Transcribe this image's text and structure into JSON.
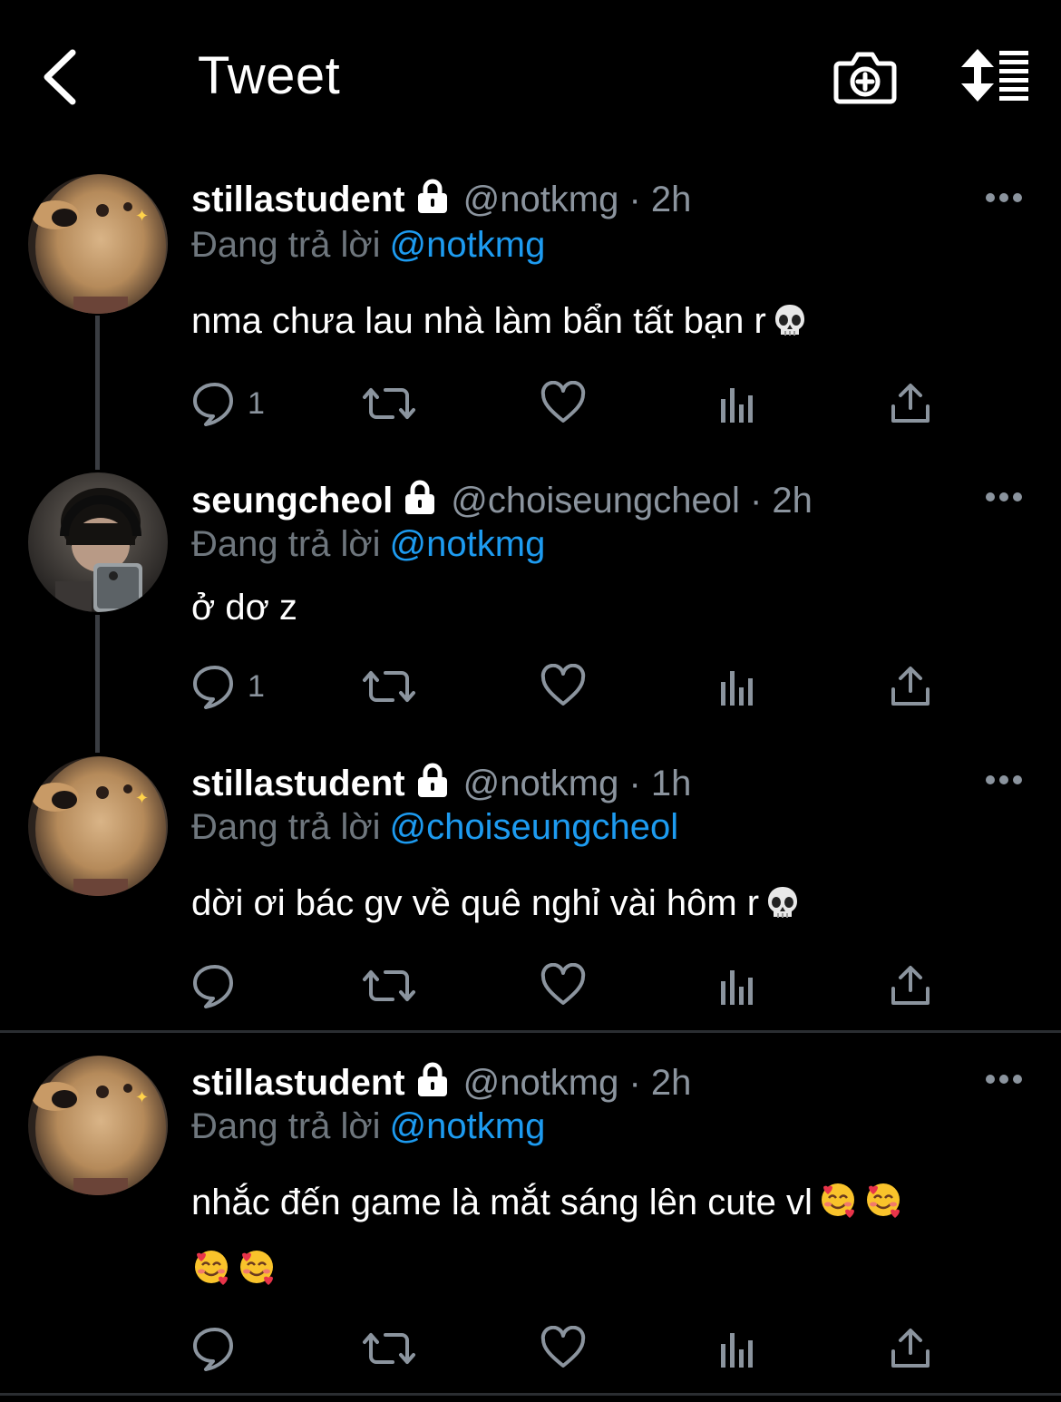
{
  "header": {
    "title": "Tweet"
  },
  "tweets": [
    {
      "display_name": "stillastudent",
      "handle_time": "@notkmg · 2h",
      "replying_label": "Đang trả lời",
      "replying_to": "@notkmg",
      "text": "nma chưa lau nhà làm bẩn tất bạn r",
      "emojis": [
        "skull"
      ],
      "reply_count": "1",
      "avatar": "golden-retriever-puppy"
    },
    {
      "display_name": "seungcheol",
      "handle_time": "@choiseungcheol · 2h",
      "replying_label": "Đang trả lời",
      "replying_to": "@notkmg",
      "text": "ở dơ z",
      "emojis": [],
      "reply_count": "1",
      "avatar": "person-with-headphones-selfie"
    },
    {
      "display_name": "stillastudent",
      "handle_time": "@notkmg · 1h",
      "replying_label": "Đang trả lời",
      "replying_to": "@choiseungcheol",
      "text": "dời ơi bác gv về quê nghỉ vài hôm r",
      "emojis": [
        "skull"
      ],
      "reply_count": "",
      "avatar": "golden-retriever-puppy"
    },
    {
      "display_name": "stillastudent",
      "handle_time": "@notkmg · 2h",
      "replying_label": "Đang trả lời",
      "replying_to": "@notkmg",
      "text": "nhắc đến game là mắt sáng lên cute vl",
      "emojis": [
        "smiling-face-with-hearts",
        "smiling-face-with-hearts",
        "smiling-face-with-hearts",
        "smiling-face-with-hearts"
      ],
      "reply_count": "",
      "avatar": "golden-retriever-puppy"
    }
  ],
  "colors": {
    "background": "#000000",
    "mention_blue": "#1d9bf0",
    "secondary_text": "#8b949e",
    "thread_line": "#3a3d42"
  }
}
